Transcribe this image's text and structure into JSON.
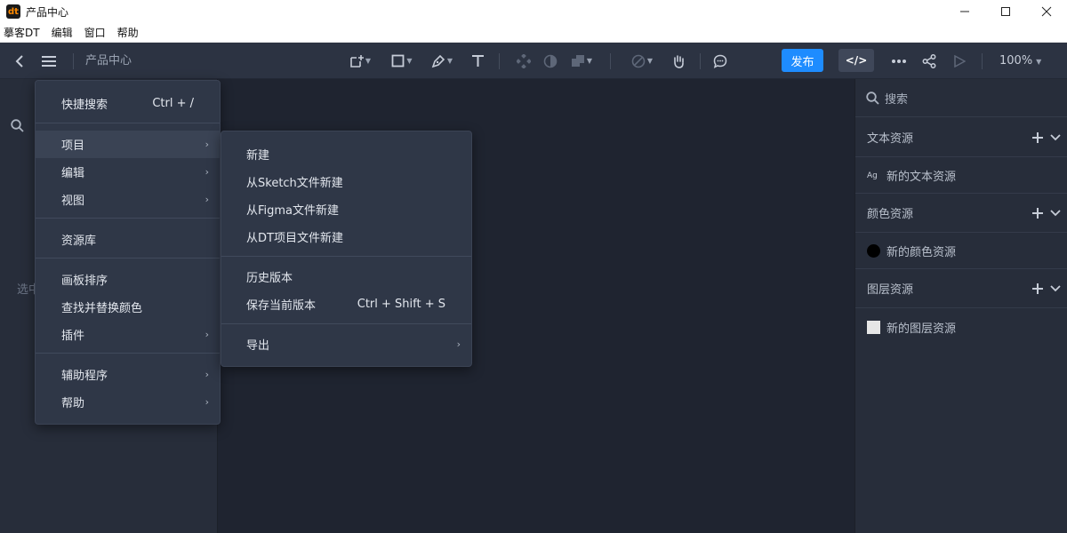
{
  "window": {
    "logo_text": "dt",
    "title": "产品中心"
  },
  "menubar": {
    "items": [
      "摹客DT",
      "编辑",
      "窗口",
      "帮助"
    ]
  },
  "toolbar": {
    "doc_name": "产品中心",
    "publish_label": "发布",
    "code_label": "</>",
    "zoom_label": "100%"
  },
  "left_panel": {
    "hint_text": "选中"
  },
  "right_panel": {
    "search_placeholder": "搜索",
    "sections": [
      {
        "title": "文本资源",
        "item_label": "新的文本资源",
        "icon_text": "Ag"
      },
      {
        "title": "颜色资源",
        "item_label": "新的颜色资源",
        "swatch": "#000000"
      },
      {
        "title": "图层资源",
        "item_label": "新的图层资源",
        "swatch": "#e6e6e6"
      }
    ]
  },
  "main_menu": {
    "items": [
      {
        "label": "快捷搜索",
        "shortcut": "Ctrl + /"
      },
      {
        "label": "项目",
        "submenu": true
      },
      {
        "label": "编辑",
        "submenu": true
      },
      {
        "label": "视图",
        "submenu": true
      },
      {
        "label": "资源库"
      },
      {
        "label": "画板排序"
      },
      {
        "label": "查找并替换颜色"
      },
      {
        "label": "插件",
        "submenu": true
      },
      {
        "label": "辅助程序",
        "submenu": true
      },
      {
        "label": "帮助",
        "submenu": true
      }
    ]
  },
  "project_submenu": {
    "items": [
      {
        "label": "新建"
      },
      {
        "label": "从Sketch文件新建"
      },
      {
        "label": "从Figma文件新建"
      },
      {
        "label": "从DT项目文件新建"
      },
      {
        "label": "历史版本"
      },
      {
        "label": "保存当前版本",
        "shortcut": "Ctrl + Shift + S"
      },
      {
        "label": "导出",
        "submenu": true
      }
    ]
  },
  "colors": {
    "accent": "#1e8cff",
    "toolbar_bg": "#2c3342",
    "panel_bg": "#272d3a",
    "canvas_bg": "#1f2430",
    "menu_bg": "#2f3747"
  }
}
